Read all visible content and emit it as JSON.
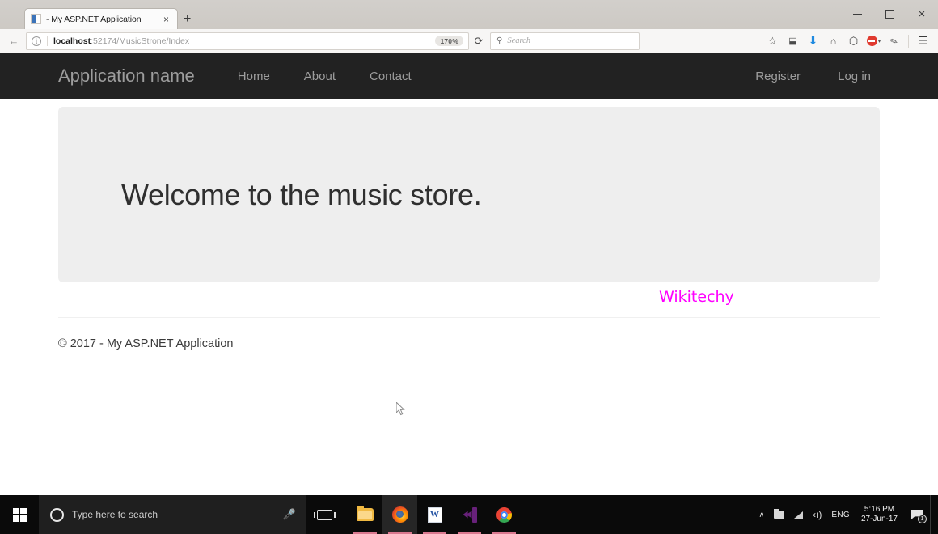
{
  "browser": {
    "tab": {
      "title": "- My ASP.NET Application",
      "favicon": "visual-studio-favicon",
      "close": "×"
    },
    "newtab_label": "+",
    "window_controls": {
      "minimize": "–",
      "maximize": "❐",
      "close": "×"
    },
    "back_icon": "←",
    "identity_icon": "i",
    "url": {
      "host": "localhost",
      "path": ":52174/MusicStrone/Index",
      "full": "localhost:52174/MusicStrone/Index"
    },
    "zoom_level": "170%",
    "reload_icon": "⟳",
    "search": {
      "icon": "⚲",
      "placeholder": "Search"
    },
    "toolbar_icons": [
      {
        "name": "bookmark-star-icon",
        "glyph": "☆"
      },
      {
        "name": "pocket-icon",
        "glyph": "⬓"
      },
      {
        "name": "download-icon",
        "glyph": "⬇"
      },
      {
        "name": "home-icon",
        "glyph": "⌂"
      },
      {
        "name": "shield-icon",
        "glyph": "⬡"
      },
      {
        "name": "adblock-icon",
        "glyph": ""
      },
      {
        "name": "dropdown-caret-icon",
        "glyph": "▾"
      },
      {
        "name": "highlighter-pen-icon",
        "glyph": "✎"
      },
      {
        "name": "hamburger-menu-icon",
        "glyph": "☰"
      }
    ]
  },
  "page": {
    "navbar": {
      "brand": "Application name",
      "links": [
        {
          "label": "Home"
        },
        {
          "label": "About"
        },
        {
          "label": "Contact"
        }
      ],
      "right_links": [
        {
          "label": "Register"
        },
        {
          "label": "Log in"
        }
      ]
    },
    "jumbotron": {
      "heading": "Welcome to the music store."
    },
    "watermark": "Wikitechy",
    "footer": {
      "copyright": "© 2017 - My ASP.NET Application"
    }
  },
  "taskbar": {
    "start_label": "start-button",
    "search": {
      "placeholder": "Type here to search",
      "mic_icon": "ᴖ"
    },
    "task_view_label": "Task View",
    "apps": [
      {
        "name": "file-explorer",
        "label": "File Explorer",
        "active": false
      },
      {
        "name": "firefox",
        "label": "Mozilla Firefox",
        "active": true
      },
      {
        "name": "word",
        "label": "Microsoft Word",
        "letter": "W",
        "active": false
      },
      {
        "name": "visual-studio",
        "label": "Visual Studio",
        "active": false
      },
      {
        "name": "chrome",
        "label": "Google Chrome",
        "active": false
      }
    ],
    "tray": {
      "chevron": "∧",
      "language": "ENG",
      "volume_icon": "‹ı)",
      "time": "5:16 PM",
      "date": "27-Jun-17",
      "notification_count": "1"
    }
  },
  "colors": {
    "navbar_bg": "#222222",
    "jumbotron_bg": "#eeeeee",
    "watermark": "#ff00ff",
    "accent_download": "#1f8ae0",
    "taskbar_bg": "#0a0a0a"
  }
}
